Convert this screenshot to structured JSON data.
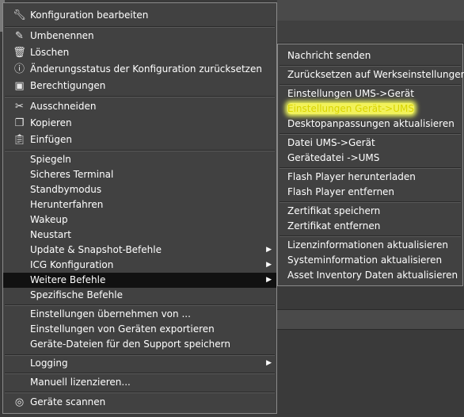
{
  "main_menu": {
    "items": [
      {
        "label": "Konfiguration bearbeiten",
        "icon": "wrench-icon"
      },
      {
        "label": "Umbenennen",
        "icon": "pencil-icon"
      },
      {
        "label": "Löschen",
        "icon": "trash-icon"
      },
      {
        "label": "Änderungsstatus der Konfiguration zurücksetzen",
        "icon": "info-icon"
      },
      {
        "label": "Berechtigungen",
        "icon": "id-card-icon"
      },
      {
        "label": "Ausschneiden",
        "icon": "scissors-icon"
      },
      {
        "label": "Kopieren",
        "icon": "copy-icon"
      },
      {
        "label": "Einfügen",
        "icon": "clipboard-icon"
      },
      {
        "label": "Spiegeln"
      },
      {
        "label": "Sicheres Terminal"
      },
      {
        "label": "Standbymodus"
      },
      {
        "label": "Herunterfahren"
      },
      {
        "label": "Wakeup"
      },
      {
        "label": "Neustart"
      },
      {
        "label": "Update & Snapshot-Befehle"
      },
      {
        "label": "ICG Konfiguration"
      },
      {
        "label": "Weitere Befehle"
      },
      {
        "label": "Spezifische Befehle"
      },
      {
        "label": "Einstellungen übernehmen von ..."
      },
      {
        "label": "Einstellungen von Geräten exportieren"
      },
      {
        "label": "Geräte-Dateien für den Support speichern"
      },
      {
        "label": "Logging"
      },
      {
        "label": "Manuell lizenzieren..."
      },
      {
        "label": "Geräte scannen",
        "icon": "scan-icon"
      }
    ]
  },
  "submenu": {
    "items": [
      {
        "label": "Nachricht senden"
      },
      {
        "label": "Zurücksetzen auf Werkseinstellungen"
      },
      {
        "label": "Einstellungen UMS->Gerät"
      },
      {
        "label": "Einstellungen Gerät->UMS"
      },
      {
        "label": "Desktopanpassungen aktualisieren"
      },
      {
        "label": "Datei UMS->Gerät"
      },
      {
        "label": "Gerätedatei ->UMS"
      },
      {
        "label": "Flash Player herunterladen"
      },
      {
        "label": "Flash Player entfernen"
      },
      {
        "label": "Zertifikat speichern"
      },
      {
        "label": "Zertifikat entfernen"
      },
      {
        "label": "Lizenzinformationen aktualisieren"
      },
      {
        "label": "Systeminformation aktualisieren"
      },
      {
        "label": "Asset Inventory Daten aktualisieren"
      }
    ]
  },
  "colors": {
    "selected_bg": "#111111",
    "menu_bg": "#414141",
    "highlight": "#f2f25a"
  }
}
